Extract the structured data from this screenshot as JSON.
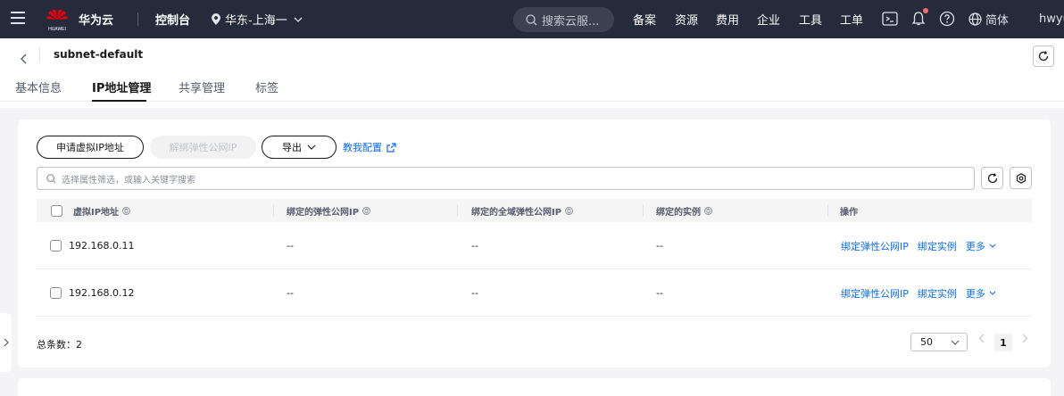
{
  "topbar": {
    "logo_text": "HUAWEI",
    "brand": "华为云",
    "console": "控制台",
    "region": "华东-上海一",
    "search_placeholder": "搜索云服...",
    "nav": [
      "备案",
      "资源",
      "费用",
      "企业",
      "工具",
      "工单"
    ],
    "language": "简体",
    "user": "hwyu"
  },
  "header": {
    "title": "subnet-default",
    "tabs": [
      "基本信息",
      "IP地址管理",
      "共享管理",
      "标签"
    ],
    "active_tab": "IP地址管理"
  },
  "toolbar": {
    "apply_label": "申请虚拟IP地址",
    "unbind_label": "解绑弹性公网IP",
    "export_label": "导出",
    "guide_label": "教我配置"
  },
  "filter": {
    "placeholder": "选择属性筛选，或输入关键字搜索"
  },
  "table": {
    "headers": [
      "虚拟IP地址",
      "绑定的弹性公网IP",
      "绑定的全域弹性公网IP",
      "绑定的实例",
      "操作"
    ],
    "rows": [
      {
        "ip": "192.168.0.11",
        "eip": "--",
        "global_eip": "--",
        "instance": "--",
        "op_bind_eip": "绑定弹性公网IP",
        "op_bind_instance": "绑定实例",
        "op_more": "更多"
      },
      {
        "ip": "192.168.0.12",
        "eip": "--",
        "global_eip": "--",
        "instance": "--",
        "op_bind_eip": "绑定弹性公网IP",
        "op_bind_instance": "绑定实例",
        "op_more": "更多"
      }
    ]
  },
  "pagination": {
    "total_label": "总条数：",
    "total": "2",
    "page_size": "50",
    "current_page": "1"
  },
  "colors": {
    "topbar_bg": "#252b3a",
    "link": "#0a6cf3",
    "notification_dot": "#f66f6a"
  }
}
